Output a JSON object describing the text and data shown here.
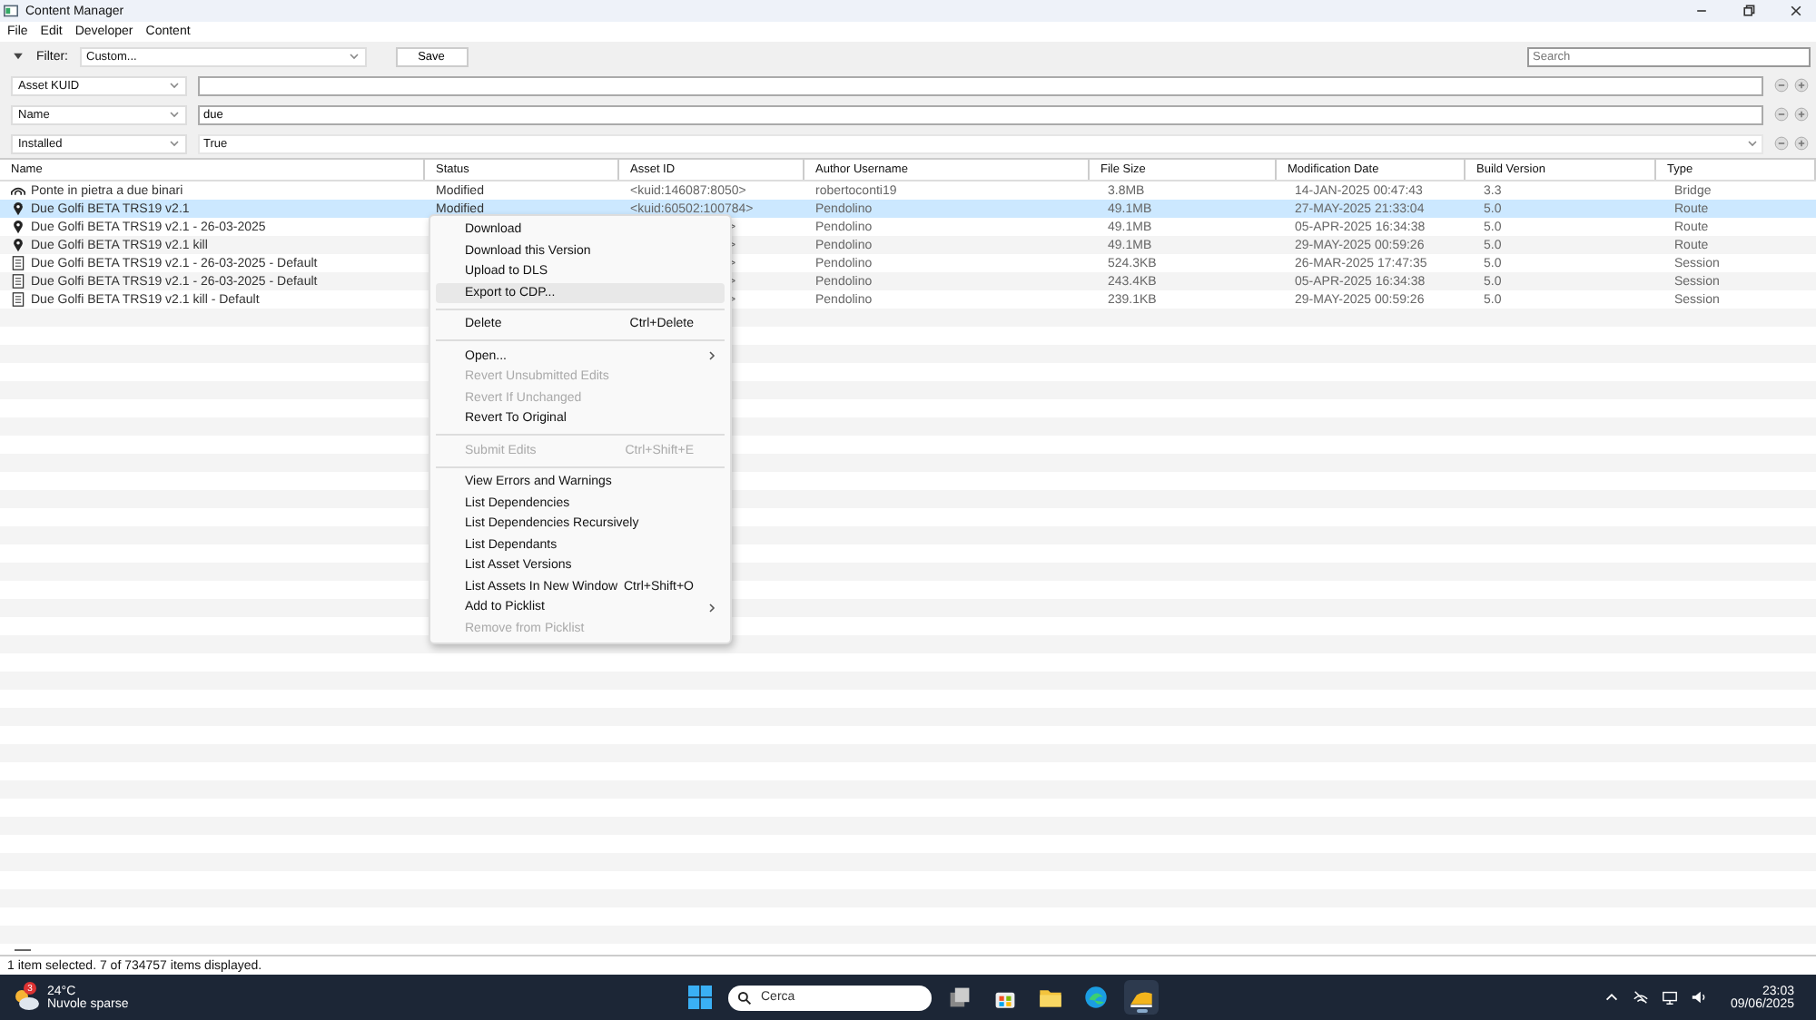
{
  "window": {
    "title": "Content Manager"
  },
  "menubar": [
    "File",
    "Edit",
    "Developer",
    "Content"
  ],
  "filter": {
    "label": "Filter:",
    "preset": "Custom...",
    "save": "Save",
    "search_placeholder": "Search"
  },
  "filter_rows": [
    {
      "field": "Asset KUID",
      "kind": "text",
      "value": ""
    },
    {
      "field": "Name",
      "kind": "text",
      "value": "due"
    },
    {
      "field": "Installed",
      "kind": "dropdown",
      "value": "True"
    }
  ],
  "table": {
    "columns": [
      "Name",
      "Status",
      "Asset ID",
      "Author Username",
      "File Size",
      "Modification Date",
      "Build Version",
      "Type"
    ],
    "rows": [
      {
        "kind": "bridge",
        "name": "Ponte in pietra a due binari",
        "status": "Modified",
        "asset_id": "<kuid:146087:8050>",
        "author": "robertoconti19",
        "size": "3.8MB",
        "date": "14-JAN-2025 00:47:43",
        "build": "3.3",
        "type": "Bridge",
        "selected": false,
        "covered": false
      },
      {
        "kind": "pin",
        "name": "Due Golfi BETA TRS19 v2.1",
        "status": "Modified",
        "asset_id": "<kuid:60502:100784>",
        "author": "Pendolino",
        "size": "49.1MB",
        "date": "27-MAY-2025 21:33:04",
        "build": "5.0",
        "type": "Route",
        "selected": true,
        "covered": false
      },
      {
        "kind": "pin",
        "name": "Due Golfi BETA TRS19 v2.1 - 26-03-2025",
        "asset_id": ">",
        "author": "Pendolino",
        "size": "49.1MB",
        "date": "05-APR-2025 16:34:38",
        "build": "5.0",
        "type": "Route",
        "selected": false,
        "covered": true
      },
      {
        "kind": "pin",
        "name": "Due Golfi BETA TRS19 v2.1 kill",
        "asset_id": ">",
        "author": "Pendolino",
        "size": "49.1MB",
        "date": "29-MAY-2025 00:59:26",
        "build": "5.0",
        "type": "Route",
        "selected": false,
        "covered": true
      },
      {
        "kind": "session",
        "name": "Due Golfi BETA TRS19 v2.1 - 26-03-2025 - Default",
        "asset_id": ">",
        "author": "Pendolino",
        "size": "524.3KB",
        "date": "26-MAR-2025 17:47:35",
        "build": "5.0",
        "type": "Session",
        "selected": false,
        "covered": true
      },
      {
        "kind": "session",
        "name": "Due Golfi BETA TRS19 v2.1 - 26-03-2025 - Default",
        "asset_id": ">",
        "author": "Pendolino",
        "size": "243.4KB",
        "date": "05-APR-2025 16:34:38",
        "build": "5.0",
        "type": "Session",
        "selected": false,
        "covered": true
      },
      {
        "kind": "session",
        "name": "Due Golfi BETA TRS19 v2.1 kill - Default",
        "asset_id": ">",
        "author": "Pendolino",
        "size": "239.1KB",
        "date": "29-MAY-2025 00:59:26",
        "build": "5.0",
        "type": "Session",
        "selected": false,
        "covered": true
      }
    ]
  },
  "context_menu": [
    {
      "kind": "item",
      "label": "Download",
      "disabled": false,
      "highlighted": false
    },
    {
      "kind": "item",
      "label": "Download this Version",
      "disabled": false,
      "highlighted": false
    },
    {
      "kind": "item",
      "label": "Upload to DLS",
      "disabled": false,
      "highlighted": false
    },
    {
      "kind": "item",
      "label": "Export to CDP...",
      "disabled": false,
      "highlighted": true
    },
    {
      "kind": "separator"
    },
    {
      "kind": "item",
      "label": "Delete",
      "shortcut": "Ctrl+Delete",
      "disabled": false,
      "highlighted": false
    },
    {
      "kind": "separator"
    },
    {
      "kind": "item",
      "label": "Open...",
      "submenu": true,
      "disabled": false,
      "highlighted": false
    },
    {
      "kind": "item",
      "label": "Revert Unsubmitted Edits",
      "disabled": true,
      "highlighted": false
    },
    {
      "kind": "item",
      "label": "Revert If Unchanged",
      "disabled": true,
      "highlighted": false
    },
    {
      "kind": "item",
      "label": "Revert To Original",
      "disabled": false,
      "highlighted": false
    },
    {
      "kind": "separator"
    },
    {
      "kind": "item",
      "label": "Submit Edits",
      "shortcut": "Ctrl+Shift+E",
      "disabled": true,
      "highlighted": false
    },
    {
      "kind": "separator"
    },
    {
      "kind": "item",
      "label": "View Errors and Warnings",
      "disabled": false,
      "highlighted": false
    },
    {
      "kind": "item",
      "label": "List Dependencies",
      "disabled": false,
      "highlighted": false
    },
    {
      "kind": "item",
      "label": "List Dependencies Recursively",
      "disabled": false,
      "highlighted": false
    },
    {
      "kind": "item",
      "label": "List Dependants",
      "disabled": false,
      "highlighted": false
    },
    {
      "kind": "item",
      "label": "List Asset Versions",
      "disabled": false,
      "highlighted": false
    },
    {
      "kind": "item",
      "label": "List Assets In New Window",
      "shortcut": "Ctrl+Shift+O",
      "disabled": false,
      "highlighted": false
    },
    {
      "kind": "item",
      "label": "Add to Picklist",
      "submenu": true,
      "disabled": false,
      "highlighted": false
    },
    {
      "kind": "item",
      "label": "Remove from Picklist",
      "disabled": true,
      "highlighted": false
    }
  ],
  "status_bar": "1 item selected. 7 of 734757 items displayed.",
  "taskbar": {
    "weather": {
      "badge": "3",
      "temp": "24°C",
      "desc": "Nuvole sparse"
    },
    "search_placeholder": "Cerca",
    "apps": [
      {
        "kind": "taskview",
        "active": false
      },
      {
        "kind": "store",
        "active": false
      },
      {
        "kind": "folder",
        "active": false
      },
      {
        "kind": "edge",
        "active": false
      },
      {
        "kind": "app",
        "active": true
      }
    ],
    "time": "23:03",
    "date": "09/06/2025"
  }
}
